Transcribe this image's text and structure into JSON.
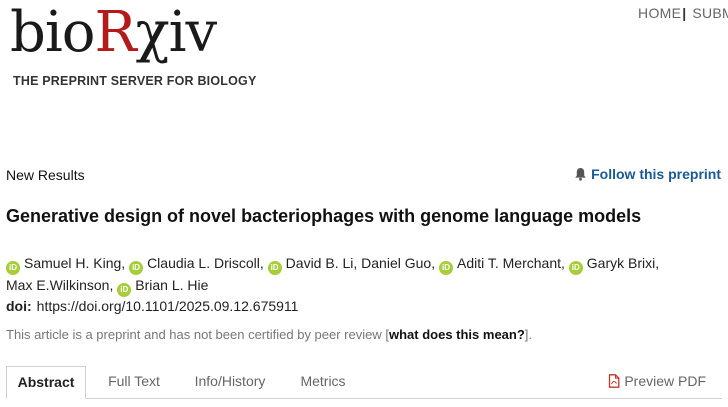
{
  "logo": {
    "word_before": "bio",
    "word_r": "R",
    "word_after": "χiv",
    "tagline": "THE PREPRINT SERVER FOR BIOLOGY"
  },
  "topnav": {
    "home": "HOME",
    "submit": "SUBM"
  },
  "section_label": "New Results",
  "follow_label": "Follow this preprint",
  "title": "Generative design of novel bacteriophages with genome language models",
  "authors": [
    "Samuel H. King",
    "Claudia L. Driscoll",
    "David B. Li",
    "Daniel Guo",
    "Aditi T. Merchant",
    "Garyk Brixi",
    "Max E.Wilkinson",
    "Brian L. Hie"
  ],
  "doi": {
    "label": "doi:",
    "value": "https://doi.org/10.1101/2025.09.12.675911"
  },
  "notice": {
    "prefix": "This article is a preprint and has not been certified by peer review [",
    "link": "what does this mean?",
    "suffix": "]."
  },
  "tabs": [
    "Abstract",
    "Full Text",
    "Info/History",
    "Metrics"
  ],
  "active_tab": "Abstract",
  "preview_pdf": "Preview PDF",
  "colors": {
    "brand_red": "#b31b1b",
    "link_blue": "#1a5a96",
    "orcid_green": "#a6ce39"
  },
  "icons": {
    "follow": "bell-icon",
    "pdf": "pdf-file-icon",
    "orcid": "orcid-icon"
  }
}
